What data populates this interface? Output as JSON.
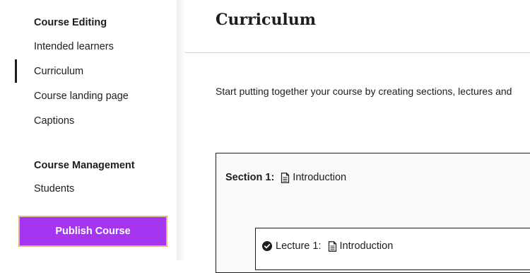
{
  "sidebar": {
    "course_editing_title": "Course Editing",
    "editing_items": [
      {
        "label": "Intended learners"
      },
      {
        "label": "Curriculum",
        "active": true
      },
      {
        "label": "Course landing page"
      },
      {
        "label": "Captions"
      }
    ],
    "course_management_title": "Course Management",
    "management_items": [
      {
        "label": "Students"
      }
    ],
    "publish_label": "Publish Course"
  },
  "main": {
    "title": "Curriculum",
    "intro_text": "Start putting together your course by creating sections, lectures and",
    "section": {
      "label": "Section 1:",
      "title": "Introduction",
      "lecture": {
        "label": "Lecture 1:",
        "title": "Introduction"
      }
    }
  },
  "colors": {
    "accent": "#a435f0",
    "publish_border": "#d7b98a",
    "text": "#1c1d1f",
    "section_bg": "#f7f9fa"
  },
  "icons": [
    "document-icon",
    "check-circle-icon"
  ]
}
